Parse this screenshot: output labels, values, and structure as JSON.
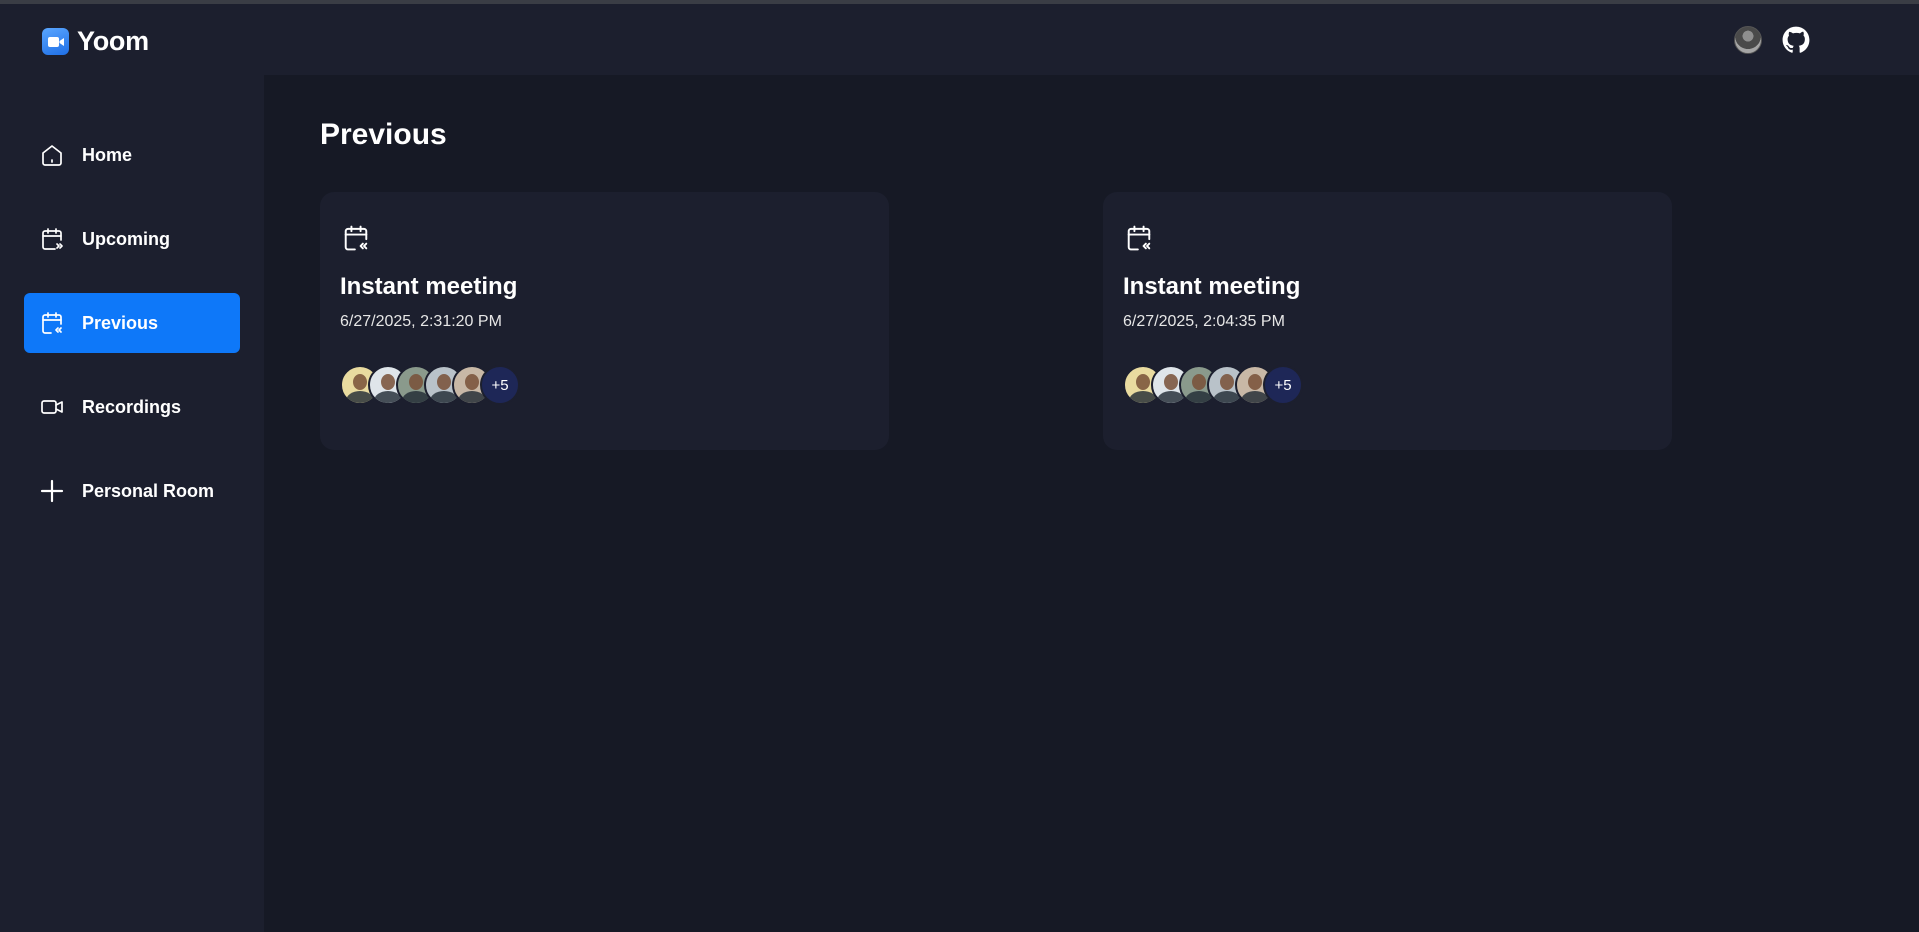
{
  "brand": {
    "name": "Yoom"
  },
  "sidebar": {
    "items": [
      {
        "label": "Home",
        "icon": "home-icon"
      },
      {
        "label": "Upcoming",
        "icon": "calendar-upcoming-icon"
      },
      {
        "label": "Previous",
        "icon": "calendar-previous-icon",
        "active": true
      },
      {
        "label": "Recordings",
        "icon": "video-icon"
      },
      {
        "label": "Personal Room",
        "icon": "plus-icon"
      }
    ]
  },
  "main": {
    "title": "Previous",
    "meetings": [
      {
        "title": "Instant meeting",
        "time": "6/27/2025, 2:31:20 PM",
        "extra_attendees": "+5"
      },
      {
        "title": "Instant meeting",
        "time": "6/27/2025, 2:04:35 PM",
        "extra_attendees": "+5"
      }
    ]
  },
  "colors": {
    "background": "#161925",
    "panel": "#1c1f2e",
    "accent": "#0e78f9",
    "badge": "#1e2757"
  }
}
